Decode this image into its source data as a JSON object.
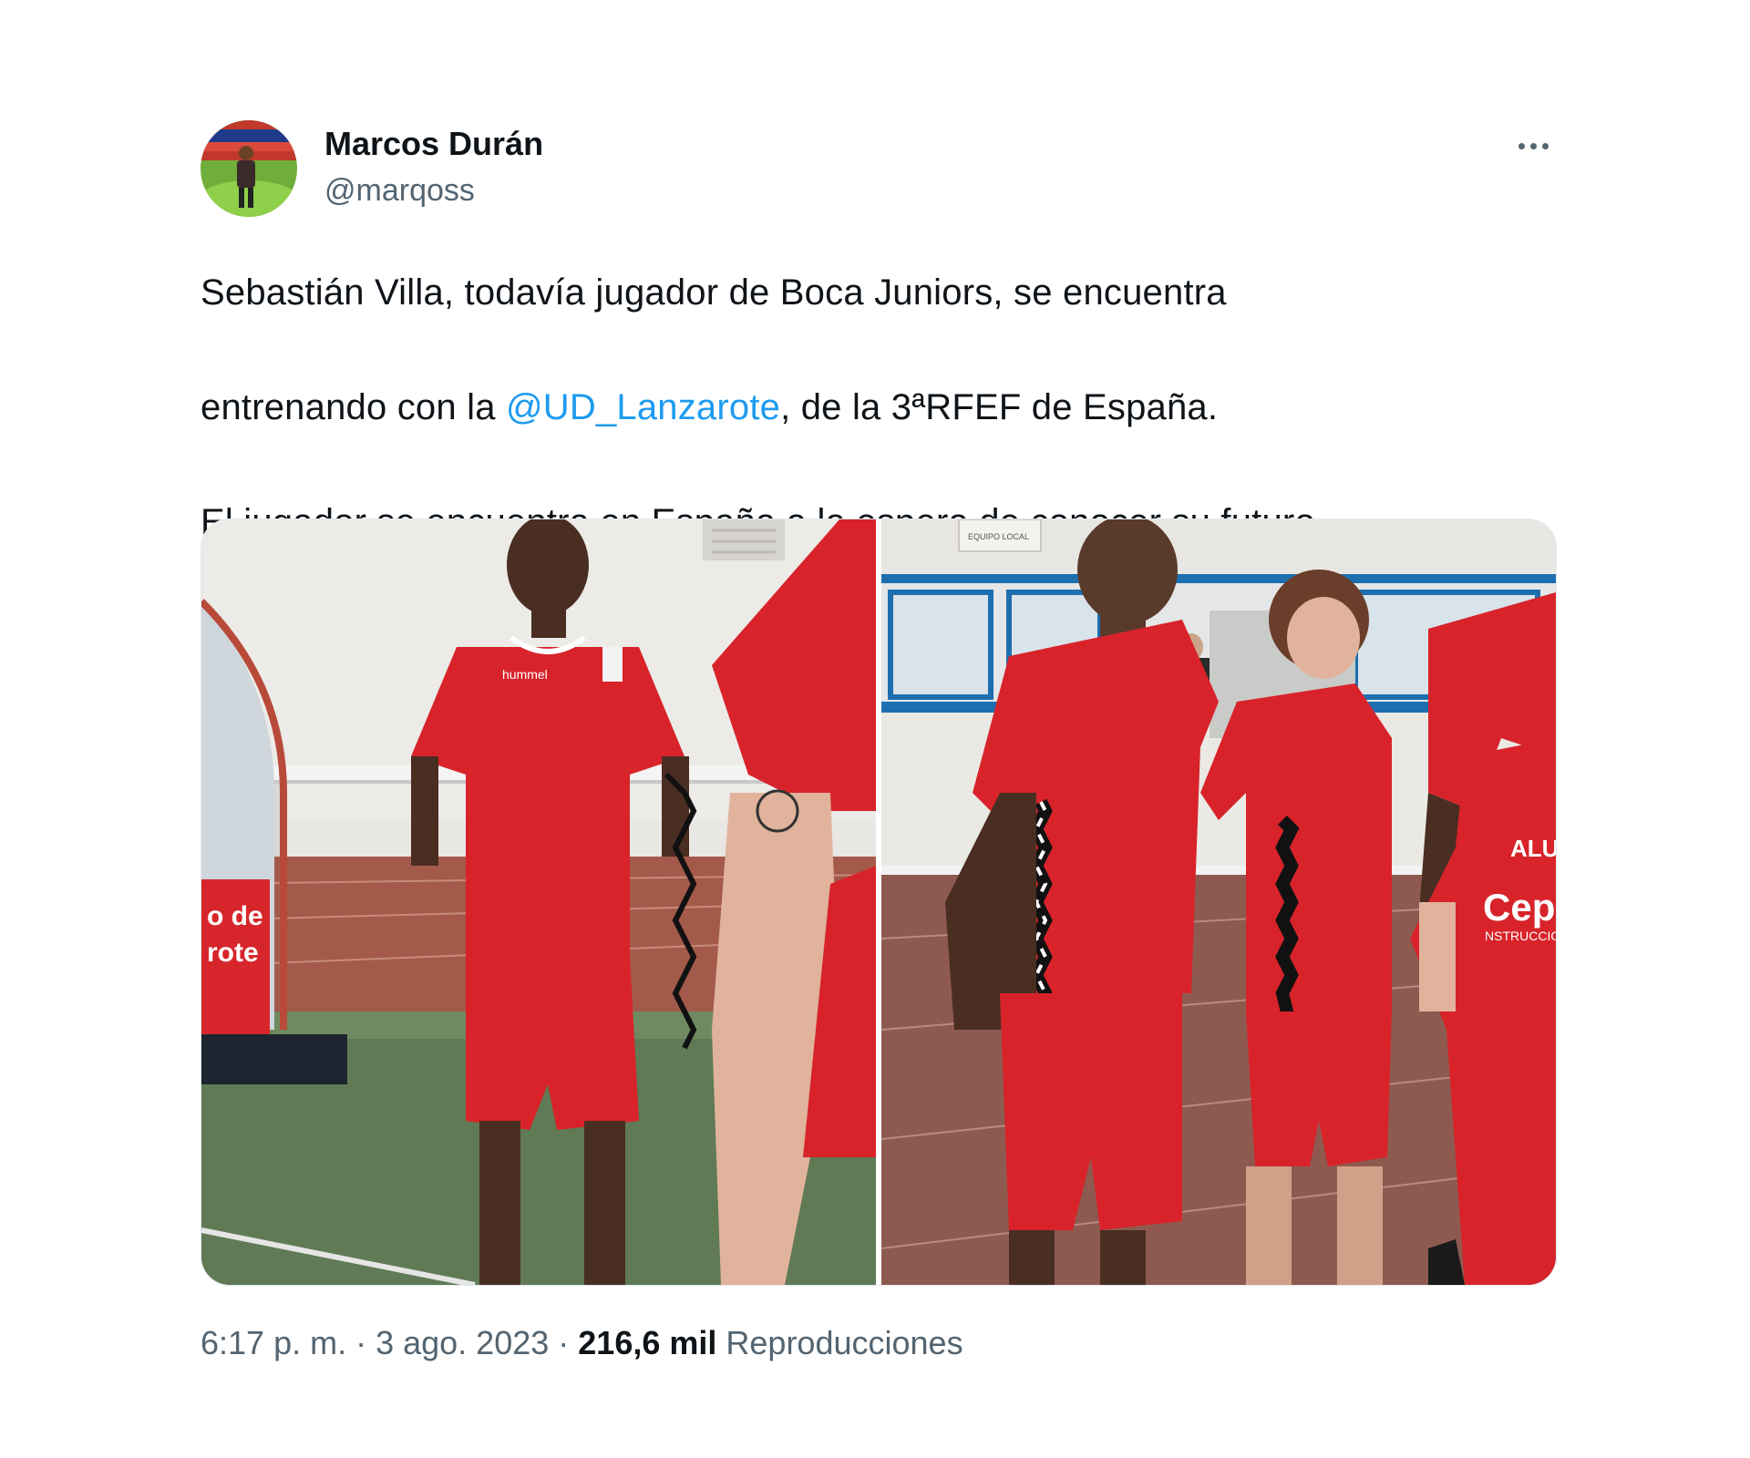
{
  "author": {
    "display_name": "Marcos Durán",
    "handle": "@marqoss"
  },
  "tweet": {
    "text_line1": "Sebastián Villa, todavía jugador de Boca Juniors, se encuentra",
    "text_line2_before": "entrenando con la ",
    "mention": "@UD_Lanzarote",
    "text_line2_after": ", de la 3ªRFEF de España.",
    "text_para2": "El jugador se encuentra en España a la espera de conocer su futuro."
  },
  "photos": {
    "left": {
      "banner_lines": [
        "o de",
        "rote"
      ],
      "brand": "hummel"
    },
    "right": {
      "sign_text": "EQUIPO LOCAL",
      "sponsor_top": "ALUM",
      "sponsor_bottom": "Cepa",
      "sponsor_sub": "NSTRUCCIO"
    }
  },
  "meta": {
    "time": "6:17 p. m.",
    "separator": "·",
    "date": "3 ago. 2023",
    "views_count": "216,6 mil",
    "views_label": "Reproducciones"
  },
  "icons": {
    "more": "more-horizontal-icon"
  }
}
